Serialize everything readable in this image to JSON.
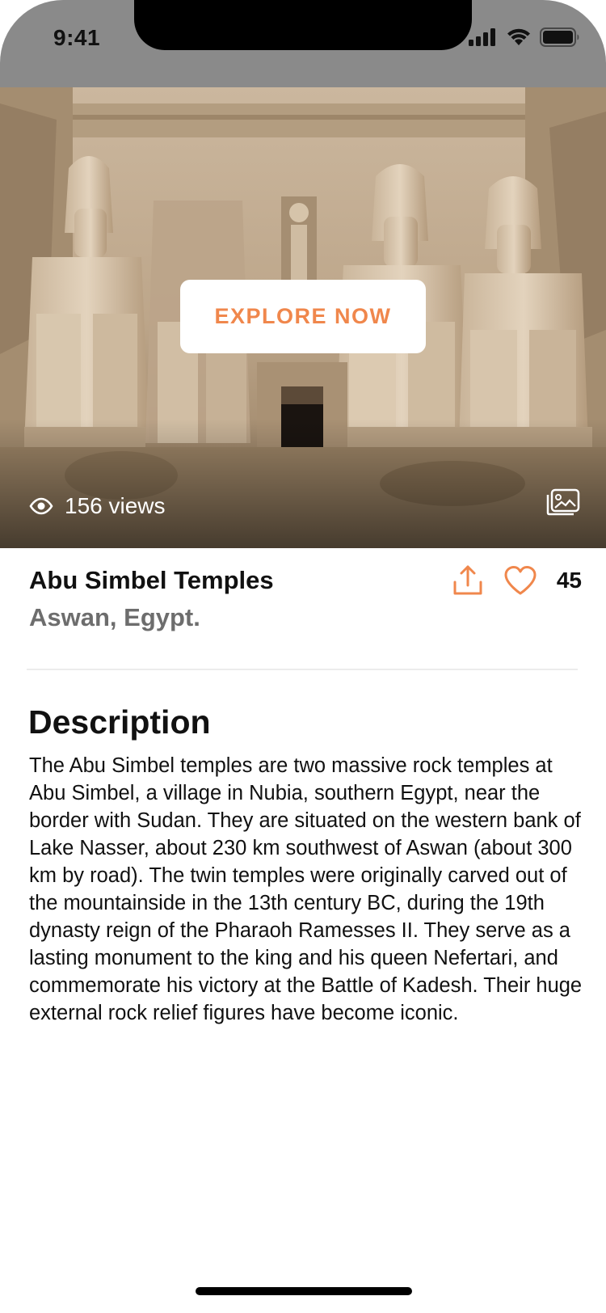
{
  "status_bar": {
    "time": "9:41"
  },
  "hero": {
    "explore_label": "EXPLORE NOW",
    "views_label": "156 views"
  },
  "place": {
    "title": "Abu Simbel Temples",
    "location": "Aswan, Egypt.",
    "likes": "45"
  },
  "description": {
    "heading": "Description",
    "body": "The Abu Simbel temples are two massive rock temples at Abu Simbel, a village in Nubia, southern Egypt, near the border with Sudan. They are situated on the western bank of Lake Nasser, about 230 km southwest of Aswan (about 300 km by road). The twin temples were originally carved out of the mountainside in the 13th century BC, during the 19th dynasty reign of the Pharaoh Ramesses II. They serve as a lasting monument to the king and his queen Nefertari, and commemorate his victory at the Battle of Kadesh. Their huge external rock relief figures have become iconic."
  },
  "colors": {
    "accent": "#f0874c",
    "status_bar_bg": "#8a8a8a",
    "muted_text": "#6d6d6d"
  },
  "icons": [
    "signal-icon",
    "wifi-icon",
    "battery-icon",
    "eye-icon",
    "gallery-icon",
    "share-icon",
    "heart-icon"
  ]
}
